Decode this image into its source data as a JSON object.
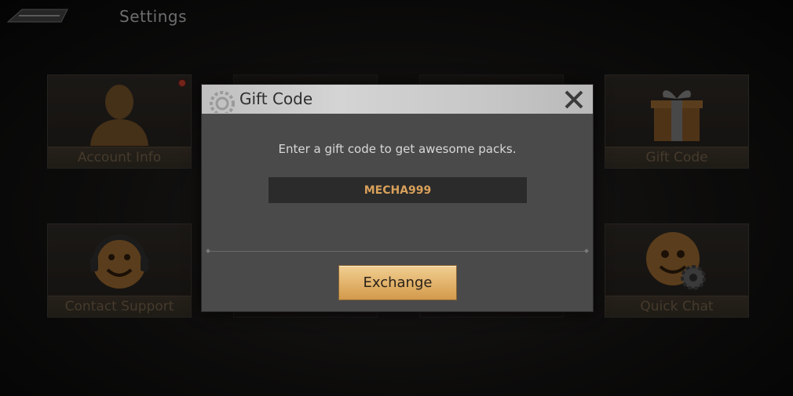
{
  "header": {
    "title": "Settings",
    "back_icon": "back-arrow-icon"
  },
  "tiles": [
    {
      "label": "Account Info",
      "icon": "person-icon",
      "notification": true
    },
    {
      "label": "Contact Support",
      "icon": "headset-smiley-icon",
      "notification": false
    },
    {
      "label": "Gift Code",
      "icon": "gift-box-icon",
      "notification": false
    },
    {
      "label": "Quick Chat",
      "icon": "smiley-gear-icon",
      "notification": false
    }
  ],
  "dialog": {
    "title": "Gift Code",
    "subtitle": "Enter a gift code to get awesome packs.",
    "code_value": "MECHA999",
    "exchange_label": "Exchange",
    "close_icon": "close-icon"
  },
  "colors": {
    "accent_gold": "#d9a05a",
    "button_gold": "#e3b46d",
    "dialog_bg": "#4a4a4a",
    "header_bg": "#c8c8c8",
    "tile_label": "#6b5a44"
  }
}
